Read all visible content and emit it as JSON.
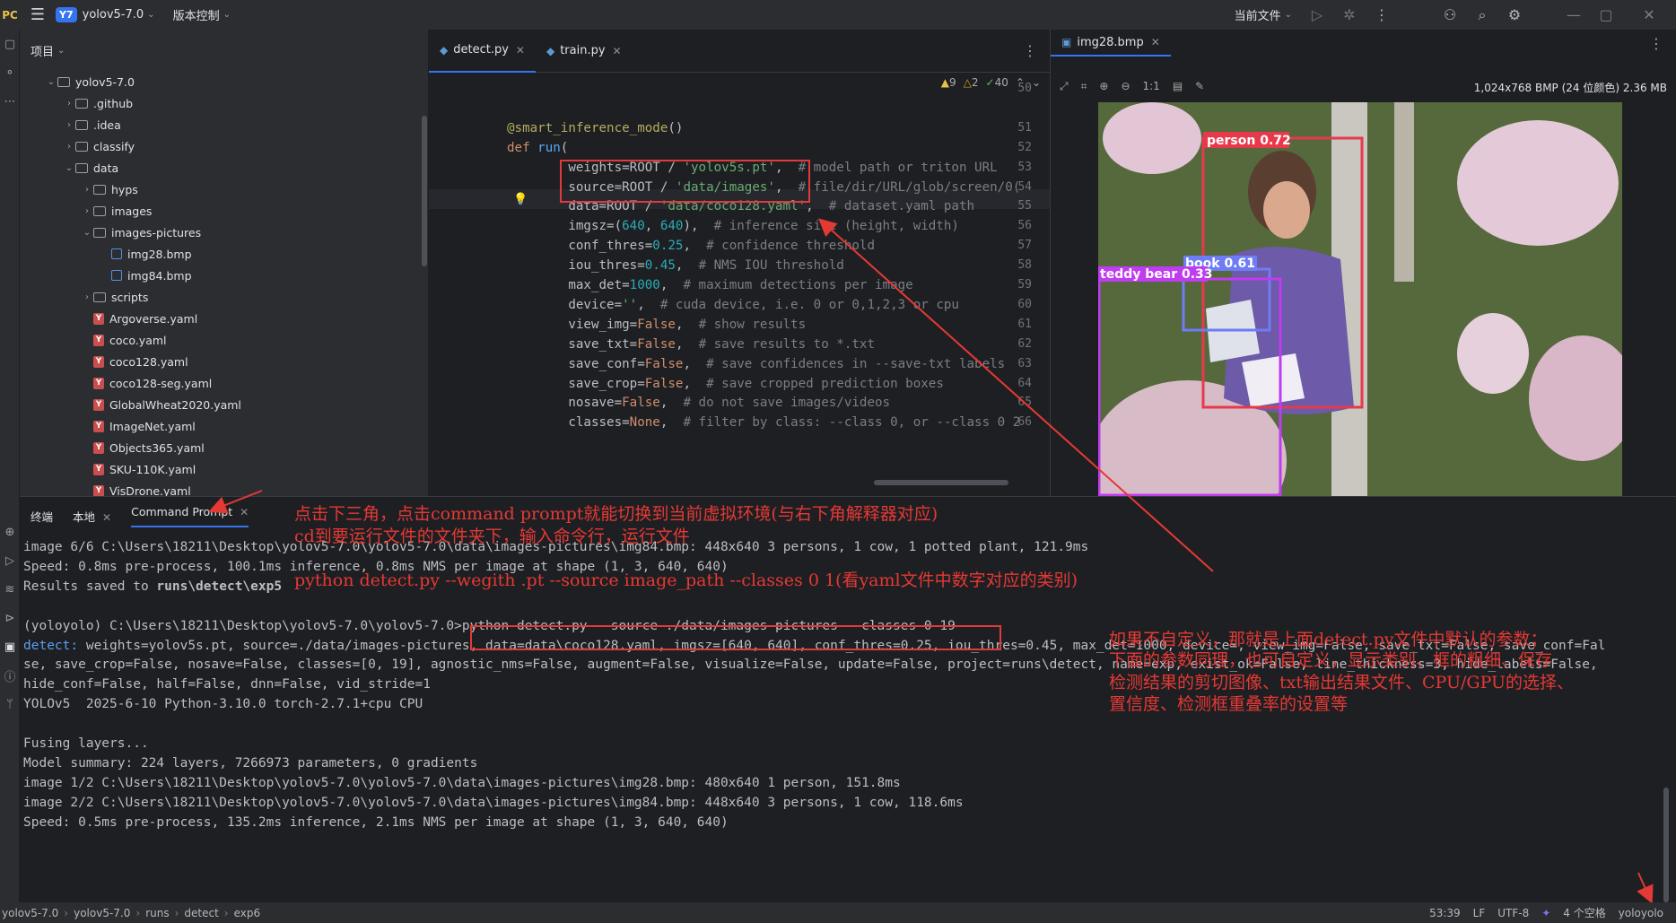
{
  "titlebar": {
    "logo": "PC",
    "project_badge": "Y7",
    "project_name": "yolov5-7.0",
    "vcs_label": "版本控制",
    "run_config": "当前文件"
  },
  "project_panel": {
    "title": "项目",
    "tree": [
      {
        "label": "yolov5-7.0",
        "kind": "folder",
        "indent": 1,
        "caret": "v"
      },
      {
        "label": ".github",
        "kind": "folder",
        "indent": 2,
        "caret": ">"
      },
      {
        "label": ".idea",
        "kind": "folder",
        "indent": 2,
        "caret": ">"
      },
      {
        "label": "classify",
        "kind": "folder",
        "indent": 2,
        "caret": ">"
      },
      {
        "label": "data",
        "kind": "folder",
        "indent": 2,
        "caret": "v"
      },
      {
        "label": "hyps",
        "kind": "folder",
        "indent": 3,
        "caret": ">"
      },
      {
        "label": "images",
        "kind": "folder",
        "indent": 3,
        "caret": ">"
      },
      {
        "label": "images-pictures",
        "kind": "folder",
        "indent": 3,
        "caret": "v"
      },
      {
        "label": "img28.bmp",
        "kind": "bmp",
        "indent": 4,
        "caret": ""
      },
      {
        "label": "img84.bmp",
        "kind": "bmp",
        "indent": 4,
        "caret": ""
      },
      {
        "label": "scripts",
        "kind": "folder",
        "indent": 3,
        "caret": ">"
      },
      {
        "label": "Argoverse.yaml",
        "kind": "yaml",
        "indent": 3,
        "caret": ""
      },
      {
        "label": "coco.yaml",
        "kind": "yaml",
        "indent": 3,
        "caret": ""
      },
      {
        "label": "coco128.yaml",
        "kind": "yaml",
        "indent": 3,
        "caret": ""
      },
      {
        "label": "coco128-seg.yaml",
        "kind": "yaml",
        "indent": 3,
        "caret": ""
      },
      {
        "label": "GlobalWheat2020.yaml",
        "kind": "yaml",
        "indent": 3,
        "caret": ""
      },
      {
        "label": "ImageNet.yaml",
        "kind": "yaml",
        "indent": 3,
        "caret": ""
      },
      {
        "label": "Objects365.yaml",
        "kind": "yaml",
        "indent": 3,
        "caret": ""
      },
      {
        "label": "SKU-110K.yaml",
        "kind": "yaml",
        "indent": 3,
        "caret": ""
      },
      {
        "label": "VisDrone.yaml",
        "kind": "yaml",
        "indent": 3,
        "caret": ""
      }
    ]
  },
  "editor": {
    "tabs": [
      {
        "label": "detect.py",
        "active": true
      },
      {
        "label": "train.py",
        "active": false
      }
    ],
    "inspections": {
      "warnings": "9",
      "weak": "2",
      "ok": "40"
    },
    "lines": [
      {
        "n": "50",
        "html": ""
      },
      {
        "n": "",
        "html": ""
      },
      {
        "n": "51",
        "html": "<span class='deco'>@smart_inference_mode</span>()"
      },
      {
        "n": "52",
        "html": "<span class='kw'>def</span> <span class='fn'>run</span>("
      },
      {
        "n": "53",
        "html": "        weights=ROOT / <span class='str'>'yolov5s.pt'</span>,  <span class='cm'># model path or triton URL</span>"
      },
      {
        "n": "54",
        "html": "        source=ROOT / <span class='str'>'data/images'</span>,  <span class='cm'># file/dir/URL/glob/screen/0(</span>"
      },
      {
        "n": "55",
        "html": "        data=ROOT / <span class='str'>'data/coco128.yaml'</span>,  <span class='cm'># dataset.yaml path</span>"
      },
      {
        "n": "56",
        "html": "        imgsz=(<span class='num'>640</span>, <span class='num'>640</span>),  <span class='cm'># inference size (height, width)</span>"
      },
      {
        "n": "57",
        "html": "        conf_thres=<span class='num'>0.25</span>,  <span class='cm'># confidence threshold</span>"
      },
      {
        "n": "58",
        "html": "        iou_thres=<span class='num'>0.45</span>,  <span class='cm'># NMS IOU threshold</span>"
      },
      {
        "n": "59",
        "html": "        max_det=<span class='num'>1000</span>,  <span class='cm'># maximum detections per image</span>"
      },
      {
        "n": "60",
        "html": "        device=<span class='str'>''</span>,  <span class='cm'># cuda device, i.e. 0 or 0,1,2,3 or cpu</span>"
      },
      {
        "n": "61",
        "html": "        view_img=<span class='kw'>False</span>,  <span class='cm'># show results</span>"
      },
      {
        "n": "62",
        "html": "        save_txt=<span class='kw'>False</span>,  <span class='cm'># save results to *.txt</span>"
      },
      {
        "n": "63",
        "html": "        save_conf=<span class='kw'>False</span>,  <span class='cm'># save confidences in --save-txt labels</span>"
      },
      {
        "n": "64",
        "html": "        save_crop=<span class='kw'>False</span>,  <span class='cm'># save cropped prediction boxes</span>"
      },
      {
        "n": "65",
        "html": "        nosave=<span class='kw'>False</span>,  <span class='cm'># do not save images/videos</span>"
      },
      {
        "n": "66",
        "html": "        classes=<span class='kw'>None</span>,  <span class='cm'># filter by class: --class 0, or --class 0 2</span>"
      }
    ]
  },
  "image_viewer": {
    "tab_label": "img28.bmp",
    "zoom_label": "1:1",
    "meta": "1,024x768 BMP (24 位颜色) 2.36 MB",
    "detections": [
      {
        "label": "person 0.72",
        "color": "#e8394b"
      },
      {
        "label": "book 0.61",
        "color": "#6e7cf5"
      },
      {
        "label": "teddy bear 0.33",
        "color": "#c03cf0"
      }
    ]
  },
  "bottom_panel": {
    "tabs": [
      {
        "label": "终端",
        "closable": false
      },
      {
        "label": "本地",
        "closable": true
      },
      {
        "label": "Command Prompt",
        "closable": true,
        "active": true
      }
    ],
    "terminal_lines": [
      "image 6/6 C:\\Users\\18211\\Desktop\\yolov5-7.0\\yolov5-7.0\\data\\images-pictures\\img84.bmp: 448x640 3 persons, 1 cow, 1 potted plant, 121.9ms",
      "Speed: 0.8ms pre-process, 100.1ms inference, 0.8ms NMS per image at shape (1, 3, 640, 640)",
      "Results saved to runs\\detect\\exp5",
      "",
      "(yoloyolo) C:\\Users\\18211\\Desktop\\yolov5-7.0\\yolov5-7.0>python detect.py --source ./data/images-pictures --classes 0 19",
      "detect: weights=yolov5s.pt, source=./data/images-pictures, data=data\\coco128.yaml, imgsz=[640, 640], conf_thres=0.25, iou_thres=0.45, max_det=1000, device=, view_img=False, save_txt=False, save_conf=Fal",
      "se, save_crop=False, nosave=False, classes=[0, 19], agnostic_nms=False, augment=False, visualize=False, update=False, project=runs\\detect, name=exp, exist_ok=False, line_thickness=3, hide_labels=False,",
      "hide_conf=False, half=False, dnn=False, vid_stride=1",
      "YOLOv5  2025-6-10 Python-3.10.0 torch-2.7.1+cpu CPU",
      "",
      "Fusing layers...",
      "Model summary: 224 layers, 7266973 parameters, 0 gradients",
      "image 1/2 C:\\Users\\18211\\Desktop\\yolov5-7.0\\yolov5-7.0\\data\\images-pictures\\img28.bmp: 480x640 1 person, 151.8ms",
      "image 2/2 C:\\Users\\18211\\Desktop\\yolov5-7.0\\yolov5-7.0\\data\\images-pictures\\img84.bmp: 448x640 3 persons, 1 cow, 118.6ms",
      "Speed: 0.5ms pre-process, 135.2ms inference, 2.1ms NMS per image at shape (1, 3, 640, 640)"
    ]
  },
  "annotations": {
    "note1_line1": "点击下三角，点击command prompt就能切换到当前虚拟环境(与右下角解释器对应)",
    "note1_line2": "cd到要运行文件的文件夹下，输入命令行，运行文件",
    "note1_line3": "python detect.py --wegith .pt --source image_path --classes 0 1(看yaml文件中数字对应的类别)",
    "note2_line1": "如果不自定义，那就是上面detect.py文件中默认的参数；",
    "note2_line2": "下面的参数同理，也可自定义，显示类别、框的粗细、保存",
    "note2_line3": "检测结果的剪切图像、txt输出结果文件、CPU/GPU的选择、",
    "note2_line4": "置信度、检测框重叠率的设置等"
  },
  "statusbar": {
    "crumbs": [
      "yolov5-7.0",
      "yolov5-7.0",
      "runs",
      "detect",
      "exp6"
    ],
    "position": "53:39",
    "line_sep": "LF",
    "encoding": "UTF-8",
    "indent": "4 个空格",
    "interpreter": "yoloyolo"
  },
  "colors": {
    "accent": "#3574f0",
    "annotation_red": "#e53935"
  }
}
